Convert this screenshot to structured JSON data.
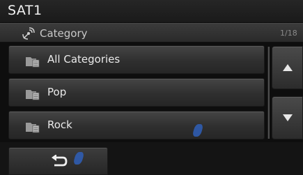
{
  "title_bar": {
    "title": "SAT1"
  },
  "subheader": {
    "label": "Category",
    "page_indicator": "1/18"
  },
  "list": {
    "items": [
      {
        "label": "All Categories"
      },
      {
        "label": "Pop"
      },
      {
        "label": "Rock"
      }
    ]
  },
  "scroll": {
    "up_icon": "triangle-up-icon",
    "down_icon": "triangle-down-icon"
  },
  "footer": {
    "back_icon": "return-arrow-icon"
  },
  "colors": {
    "background": "#0e0e0e",
    "button": "#3a3a3a",
    "text": "#eaeaea",
    "accent_marker": "#2f5fb8"
  }
}
